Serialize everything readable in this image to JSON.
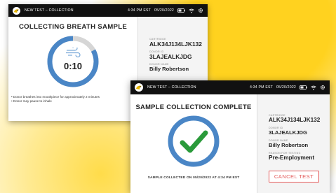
{
  "screen1": {
    "header": {
      "title": "NEW TEST – COLLECTION",
      "time": "4:34 PM EST",
      "date": "05/20/2022"
    },
    "main": {
      "title": "COLLECTING BREATH SAMPLE",
      "timer": "0:10",
      "progress": 0.83,
      "instructions": [
        "• Donor breathes into mouthpiece for approximately 2 minutes",
        "• Donor may pause to inhale"
      ]
    },
    "sidebar": {
      "cartridge_label": "CARTRIDGE",
      "cartridge_value": "ALK34J134LJK132",
      "donor_id_label": "DONOR ID",
      "donor_id_value": "3LAJEALKJDG",
      "donor_name_label": "DONOR NAME",
      "donor_name_value": "Billy Robertson"
    }
  },
  "screen2": {
    "header": {
      "title": "NEW TEST – COLLECTION",
      "time": "4:34 PM EST",
      "date": "05/20/2022"
    },
    "main": {
      "title": "SAMPLE COLLECTION COMPLETE",
      "collected_text": "SAMPLE COLLECTED ON 05/20/2022 AT 4:34 PM EST"
    },
    "sidebar": {
      "cartridge_label": "CARTRIDGE",
      "cartridge_value": "ALK34J134LJK132",
      "donor_id_label": "DONOR ID",
      "donor_id_value": "3LAJEALKJDG",
      "donor_name_label": "DONOR NAME",
      "donor_name_value": "Billy Robertson",
      "reason_label": "REASON FOR TESTING",
      "reason_value": "Pre-Employment",
      "cancel_label": "CANCEL TEST"
    }
  },
  "colors": {
    "accent_yellow": "#ffd21f",
    "ring_blue": "#4a86c6",
    "ring_track": "#d6d6d6",
    "check_green": "#2a9a3a",
    "cancel_red": "#e45b5b",
    "topbar": "#111111"
  },
  "icons": [
    "logo-icon",
    "battery-icon",
    "wifi-icon",
    "settings-icon",
    "wind-icon",
    "checkmark-icon"
  ]
}
